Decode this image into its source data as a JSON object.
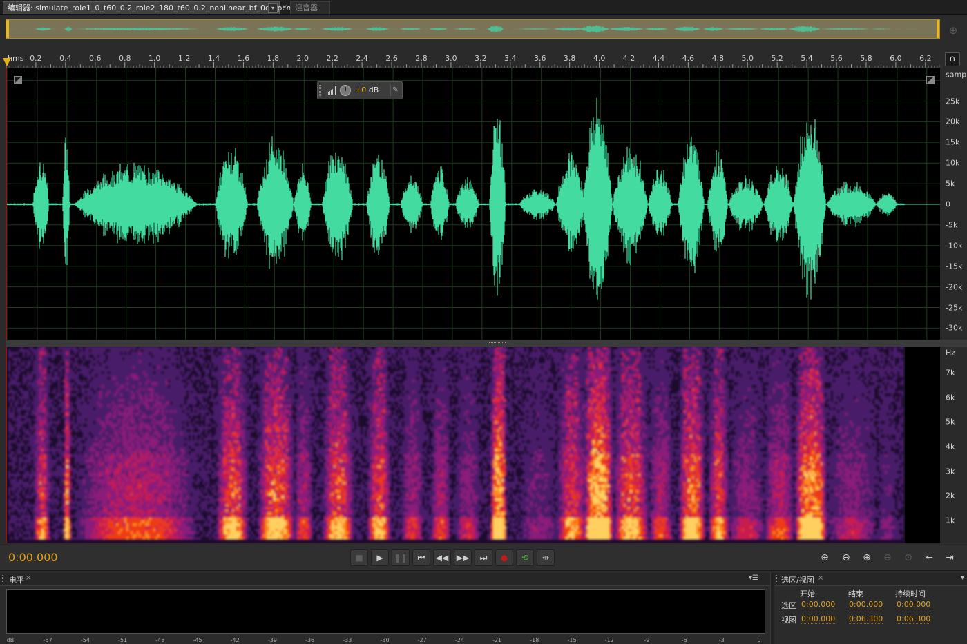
{
  "tabs": {
    "editor_label": "编辑器: simulate_role1_0_t60_0.2_role2_180_t60_0.2_nonlinear_bf_0du.pcm",
    "dropdown_glyph": "▾",
    "close_glyph": "×",
    "mixer_label": "混音器"
  },
  "overview": {
    "wave_color": "#4fbf93",
    "zoom_icon": "zoom-navigator-icon"
  },
  "ruler": {
    "unit": "hms",
    "ticks": [
      "0.2",
      "0.4",
      "0.6",
      "0.8",
      "1.0",
      "1.2",
      "1.4",
      "1.6",
      "1.8",
      "2.0",
      "2.2",
      "2.4",
      "2.6",
      "2.8",
      "3.0",
      "3.2",
      "3.4",
      "3.6",
      "3.8",
      "4.0",
      "4.2",
      "4.4",
      "4.6",
      "4.8",
      "5.0",
      "5.2",
      "5.4",
      "5.6",
      "5.8",
      "6.0",
      "6.2"
    ],
    "snap_icon": "magnet-icon"
  },
  "hud": {
    "gain_value": "+0",
    "gain_unit": " dB"
  },
  "waveform": {
    "wave_color": "#43dba0",
    "amplitude_labels": [
      "samp",
      "25k",
      "20k",
      "15k",
      "10k",
      "5k",
      "0",
      "-5k",
      "-10k",
      "-15k",
      "-20k",
      "-25k",
      "-30k"
    ]
  },
  "spectral": {
    "freq_labels": [
      "Hz",
      "7k",
      "6k",
      "5k",
      "4k",
      "3k",
      "2k",
      "1k"
    ]
  },
  "transport": {
    "time": "0:00.000",
    "buttons": [
      {
        "name": "stop-button",
        "glyph": "■",
        "enabled": false
      },
      {
        "name": "play-button",
        "glyph": "▶",
        "enabled": true
      },
      {
        "name": "pause-button",
        "glyph": "❚❚",
        "enabled": false
      },
      {
        "name": "go-to-start-button",
        "glyph": "⏮",
        "enabled": true
      },
      {
        "name": "rewind-button",
        "glyph": "◀◀",
        "enabled": true
      },
      {
        "name": "fast-forward-button",
        "glyph": "▶▶",
        "enabled": true
      },
      {
        "name": "go-to-end-button",
        "glyph": "⏭",
        "enabled": true
      },
      {
        "name": "record-button",
        "glyph": "●",
        "enabled": true
      },
      {
        "name": "loop-button",
        "glyph": "⟲",
        "enabled": true
      },
      {
        "name": "skip-selection-button",
        "glyph": "⇹",
        "enabled": true
      }
    ],
    "zoom_buttons": [
      {
        "name": "zoom-in-amplitude-button",
        "glyph": "⊕",
        "enabled": true
      },
      {
        "name": "zoom-out-amplitude-button",
        "glyph": "⊖",
        "enabled": true
      },
      {
        "name": "zoom-in-time-button",
        "glyph": "⊕",
        "enabled": true
      },
      {
        "name": "zoom-out-full-button",
        "glyph": "⊖",
        "enabled": false
      },
      {
        "name": "zoom-selection-button",
        "glyph": "⊙",
        "enabled": false
      },
      {
        "name": "zoom-in-left-button",
        "glyph": "⇤",
        "enabled": true
      },
      {
        "name": "zoom-in-right-button",
        "glyph": "⇥",
        "enabled": true
      }
    ]
  },
  "levels_panel": {
    "title": "电平",
    "close_glyph": "×",
    "menu_glyph": "▾☰",
    "scale": [
      "dB",
      "-57",
      "-54",
      "-51",
      "-48",
      "-45",
      "-42",
      "-39",
      "-36",
      "-33",
      "-30",
      "-27",
      "-24",
      "-21",
      "-18",
      "-15",
      "-12",
      "-9",
      "-6",
      "-3",
      "0"
    ]
  },
  "selection_panel": {
    "title": "选区/视图",
    "close_glyph": "×",
    "menu_glyph": "▾",
    "col_start": "开始",
    "col_end": "结束",
    "col_duration": "持续时间",
    "row_selection": "选区",
    "row_view": "视图",
    "selection_start": "0:00.000",
    "selection_end": "0:00.000",
    "selection_duration": "0:00.000",
    "view_start": "0:00.000",
    "view_end": "0:06.300",
    "view_duration": "0:06.300"
  }
}
